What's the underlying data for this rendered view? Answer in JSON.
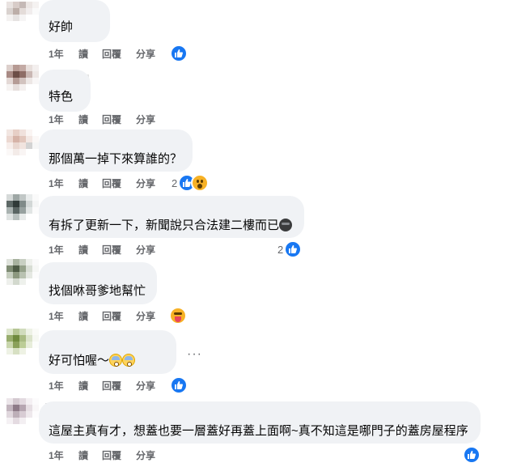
{
  "comments": [
    {
      "text": "好帥",
      "time": "1年",
      "read": "讀",
      "reply": "回覆",
      "share": "分享",
      "reaction_icon": "like-icon",
      "reaction_count": ""
    },
    {
      "text": "特色",
      "time": "1年",
      "read": "讀",
      "reply": "回覆",
      "share": "分享",
      "reaction_icon": "",
      "reaction_count": ""
    },
    {
      "text": "那個萬一掉下來算誰的？",
      "time": "1年",
      "read": "讀",
      "reply": "回覆",
      "share": "分享",
      "reaction_icon": "like-icon wow-icon",
      "reaction_count": "2"
    },
    {
      "text": "有拆了更新一下，新聞說只合法建二樓而已",
      "time": "1年",
      "read": "讀",
      "reply": "回覆",
      "share": "分享",
      "reaction_icon": "like-icon",
      "reaction_count": "2",
      "inline_emoji": "dark-face-emoji"
    },
    {
      "text": "找個咻哥爹地幫忙",
      "time": "1年",
      "read": "讀",
      "reply": "回覆",
      "share": "分享",
      "reaction_icon": "tongue-face-emoji",
      "reaction_count": ""
    },
    {
      "text": "好可怕喔～",
      "time": "1年",
      "read": "讀",
      "reply": "回覆",
      "share": "分享",
      "reaction_icon": "like-icon",
      "reaction_count": "",
      "inline_emoji": "fearful-face-emoji x2",
      "more": "···"
    },
    {
      "text": "這屋主真有才，想蓋也要一層蓋好再蓋上面啊~真不知這是哪門子的蓋房屋程序",
      "time": "1年",
      "read": "讀",
      "reply": "回覆",
      "share": "分享",
      "reaction_icon": "like-icon",
      "reaction_count": ""
    }
  ],
  "colors": {
    "bubble": "#f0f2f5",
    "meta_text": "#65676b",
    "like_blue": "#1877f2",
    "wow_yellow": "#f7b125"
  }
}
